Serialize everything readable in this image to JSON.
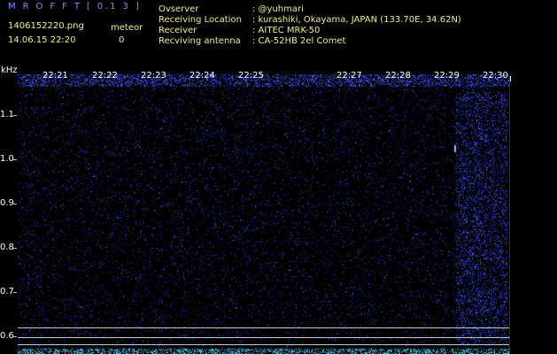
{
  "header": {
    "app_title": "M R O F F T  [ 0.1 3 ]",
    "file_name": "1406152220.png",
    "datetime": "14.06.15 22:20",
    "meteor_label": "meteor",
    "meteor_count": "0"
  },
  "info": [
    {
      "key": "Ovserver",
      "value": ": @yuhmari"
    },
    {
      "key": "Receiving Location",
      "value": ": kurashiki, Okayama, JAPAN (133.70E, 34.62N)"
    },
    {
      "key": "Receiver",
      "value": ": AITEC MRK-50"
    },
    {
      "key": "Recviving antenna",
      "value": ": CA-52HB 2el Comet"
    }
  ],
  "axis": {
    "unit": "kHz",
    "y_ticks": [
      "1.1",
      "1.0",
      "0.9",
      "0.8",
      "0.7",
      "0.6"
    ],
    "x_ticks": [
      "22:21",
      "22:22",
      "22:23",
      "22:24",
      "22:25",
      "22:27",
      "22:28",
      "22:29",
      "22:30"
    ]
  },
  "colors": {
    "noise": "#2030c8",
    "noise_bright": "#4a6cff",
    "label_yellow": "#f0f07c",
    "title_blue": "#7f8cff"
  }
}
